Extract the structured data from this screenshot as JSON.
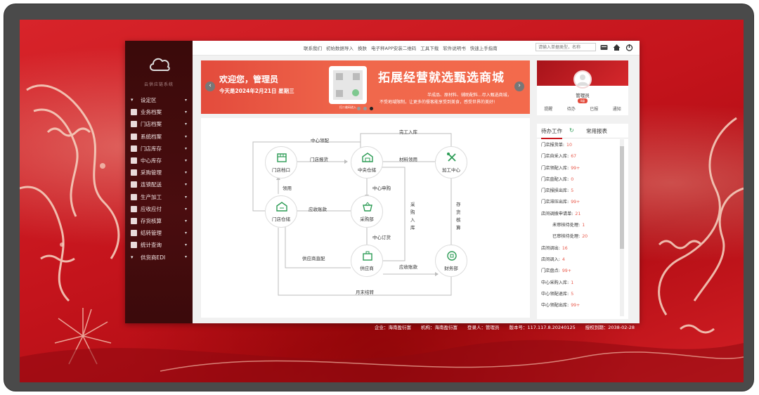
{
  "app": {
    "system_name": "云供应链系统"
  },
  "sidebar": {
    "items": [
      {
        "label": "设定区",
        "icon": "caret-icon"
      },
      {
        "label": "业务档案",
        "icon": "chart-icon"
      },
      {
        "label": "门店档案",
        "icon": "store-icon"
      },
      {
        "label": "系统档案",
        "icon": "truck-icon"
      },
      {
        "label": "门店库存",
        "icon": "box-icon"
      },
      {
        "label": "中心库存",
        "icon": "warehouse-icon"
      },
      {
        "label": "采购管理",
        "icon": "cart-icon"
      },
      {
        "label": "连锁配送",
        "icon": "delivery-icon"
      },
      {
        "label": "生产加工",
        "icon": "tools-icon"
      },
      {
        "label": "应收应付",
        "icon": "money-icon"
      },
      {
        "label": "存货核算",
        "icon": "calc-icon"
      },
      {
        "label": "结转管理",
        "icon": "layers-icon"
      },
      {
        "label": "统计查询",
        "icon": "search-doc-icon"
      },
      {
        "label": "供货商EDI",
        "icon": "caret-icon"
      }
    ]
  },
  "topbar": {
    "links": [
      "联系我们",
      "初始数据导入",
      "换肤",
      "电子秤APP安装二维码",
      "工具下载",
      "软件说明书",
      "快速上手指南"
    ],
    "search_placeholder": "请输入单据类型，名称"
  },
  "banner": {
    "welcome": "欢迎您，管理员",
    "date": "今天是2024年2月21日 星期三",
    "qr_label": "扫二维码进入",
    "promo_title": "拓展经营就选甄选商城",
    "promo_line1": "半成品、原材料、辅助配料...尽入甄选商城，",
    "promo_line2": "不受地域限制，让更多的餐客能享受到美食，感受世界的美好!"
  },
  "flow": {
    "nodes": {
      "store_outlet": "门店档口",
      "central_warehouse": "中央仓储",
      "processing_center": "加工中心",
      "store_warehouse": "门店仓储",
      "purchasing": "采购部",
      "supplier": "供应商",
      "finance": "财务部"
    },
    "labels": {
      "center_pick": "中心领配",
      "done_in": "完工入库",
      "store_pick": "门店报货",
      "material_pick": "材料领用",
      "pick_use": "领用",
      "receivable": "应收账款",
      "center_apply": "中心申购",
      "purchase_in": "采\n购\n入\n库",
      "inventory_check": "存\n货\n核\n算",
      "center_order": "中心订货",
      "supplier_direct": "供应商直配",
      "payable": "应收账款",
      "month_end": "月末结转"
    }
  },
  "profile": {
    "name": "管理员",
    "badge": "0级",
    "actions": [
      "提醒",
      "待办",
      "已报",
      "通知"
    ]
  },
  "todo": {
    "tab_active": "待办工作",
    "tab_other": "常用报表",
    "items": [
      {
        "label": "门店报货单:",
        "count": "10",
        "indent": false
      },
      {
        "label": "门店自采入库:",
        "count": "67",
        "indent": false
      },
      {
        "label": "门店领配入库:",
        "count": "99+",
        "indent": false
      },
      {
        "label": "门店直配入库:",
        "count": "0",
        "indent": false
      },
      {
        "label": "门店报损出库:",
        "count": "5",
        "indent": false
      },
      {
        "label": "门店滞压出库:",
        "count": "99+",
        "indent": false
      },
      {
        "label": "店间调拨申请单:",
        "count": "21",
        "indent": false
      },
      {
        "label": "未审核待处理:",
        "count": "1",
        "indent": true
      },
      {
        "label": "已审核待处理:",
        "count": "20",
        "indent": true
      },
      {
        "label": "店间调出:",
        "count": "16",
        "indent": false
      },
      {
        "label": "店间调入:",
        "count": "4",
        "indent": false
      },
      {
        "label": "门店盘点:",
        "count": "99+",
        "indent": false
      },
      {
        "label": "中心采购入库:",
        "count": "1",
        "indent": false
      },
      {
        "label": "中心领配退库:",
        "count": "5",
        "indent": false
      },
      {
        "label": "中心领配出库:",
        "count": "99+",
        "indent": false
      }
    ]
  },
  "status": {
    "company": "企业：海南盈衍富",
    "org": "机构：海南盈衍富",
    "user": "登录人：管理员",
    "version": "版本号：117.117.8.20240125",
    "expire": "授权到期：2038-02-28"
  },
  "colors": {
    "accent": "#c8161d",
    "sidebar_bg": "#3a0a0a",
    "banner": "#f0684c",
    "node_icon": "#2b9b54",
    "count": "#e8584a"
  }
}
